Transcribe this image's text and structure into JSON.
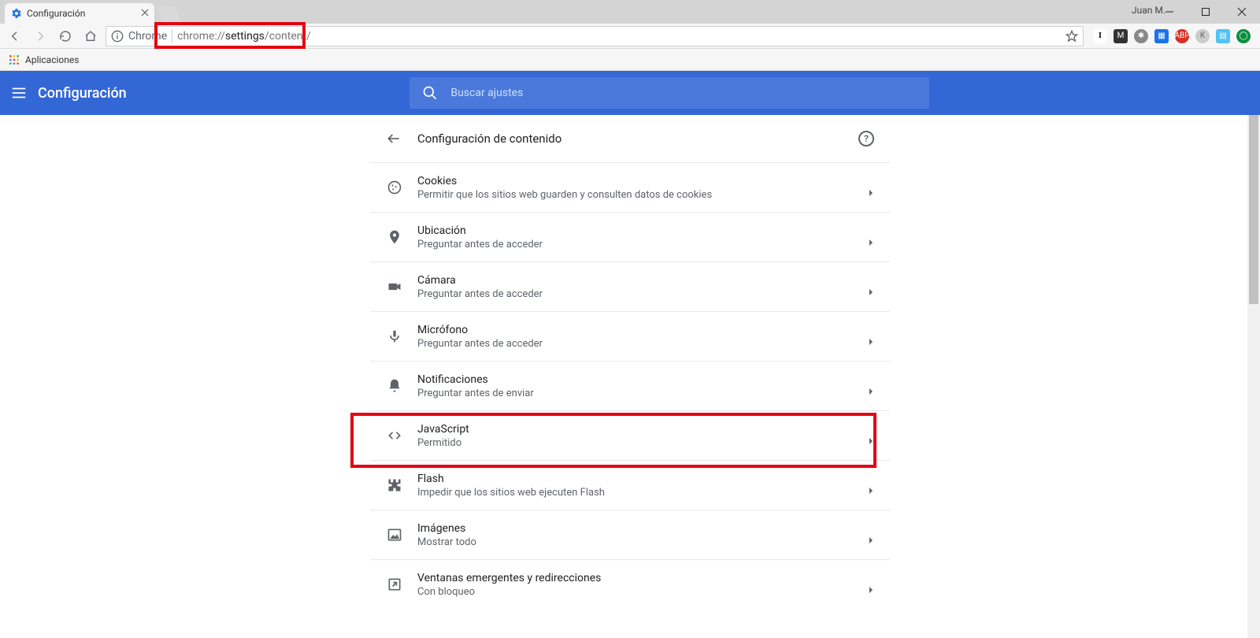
{
  "browser": {
    "tab_title": "Configuración",
    "user_label": "Juan M.",
    "url_prefix": "chrome://",
    "url_strong": "settings",
    "url_suffix": "/content/",
    "secure_label": "Chrome",
    "bookmarks_label": "Aplicaciones"
  },
  "appbar": {
    "title": "Configuración",
    "search_placeholder": "Buscar ajustes"
  },
  "panel": {
    "heading": "Configuración de contenido"
  },
  "rows": [
    {
      "key": "cookies",
      "title": "Cookies",
      "sub": "Permitir que los sitios web guarden y consulten datos de cookies"
    },
    {
      "key": "location",
      "title": "Ubicación",
      "sub": "Preguntar antes de acceder"
    },
    {
      "key": "camera",
      "title": "Cámara",
      "sub": "Preguntar antes de acceder"
    },
    {
      "key": "mic",
      "title": "Micrófono",
      "sub": "Preguntar antes de acceder"
    },
    {
      "key": "notifications",
      "title": "Notificaciones",
      "sub": "Preguntar antes de enviar"
    },
    {
      "key": "javascript",
      "title": "JavaScript",
      "sub": "Permitido"
    },
    {
      "key": "flash",
      "title": "Flash",
      "sub": "Impedir que los sitios web ejecuten Flash"
    },
    {
      "key": "images",
      "title": "Imágenes",
      "sub": "Mostrar todo"
    },
    {
      "key": "popups",
      "title": "Ventanas emergentes y redirecciones",
      "sub": "Con bloqueo"
    }
  ]
}
